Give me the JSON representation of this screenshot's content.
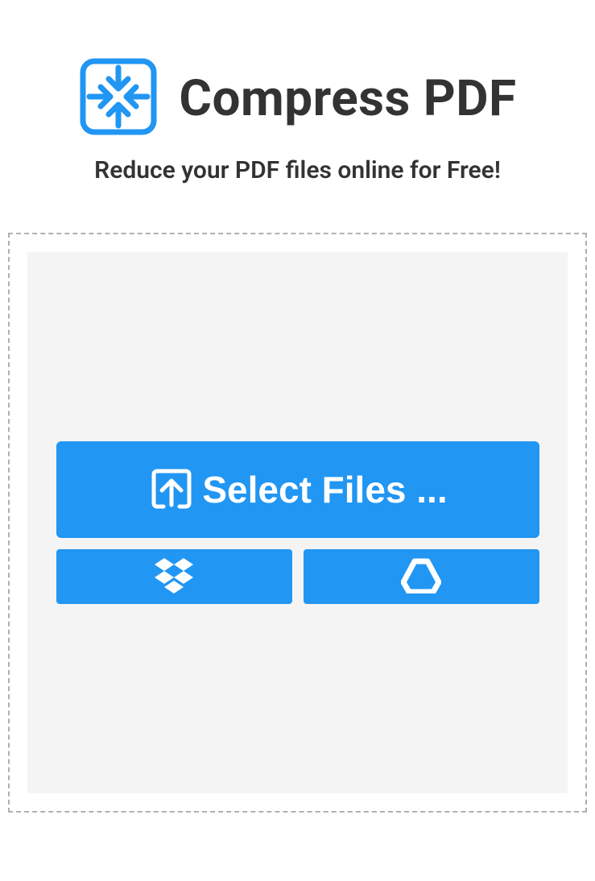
{
  "header": {
    "title": "Compress PDF",
    "subtitle": "Reduce your PDF files online for Free!"
  },
  "upload": {
    "select_label": "Select Files ..."
  },
  "colors": {
    "accent": "#2196f3",
    "text_primary": "#333333",
    "panel_bg": "#f4f4f4",
    "dropzone_border": "#b0b0b0"
  }
}
